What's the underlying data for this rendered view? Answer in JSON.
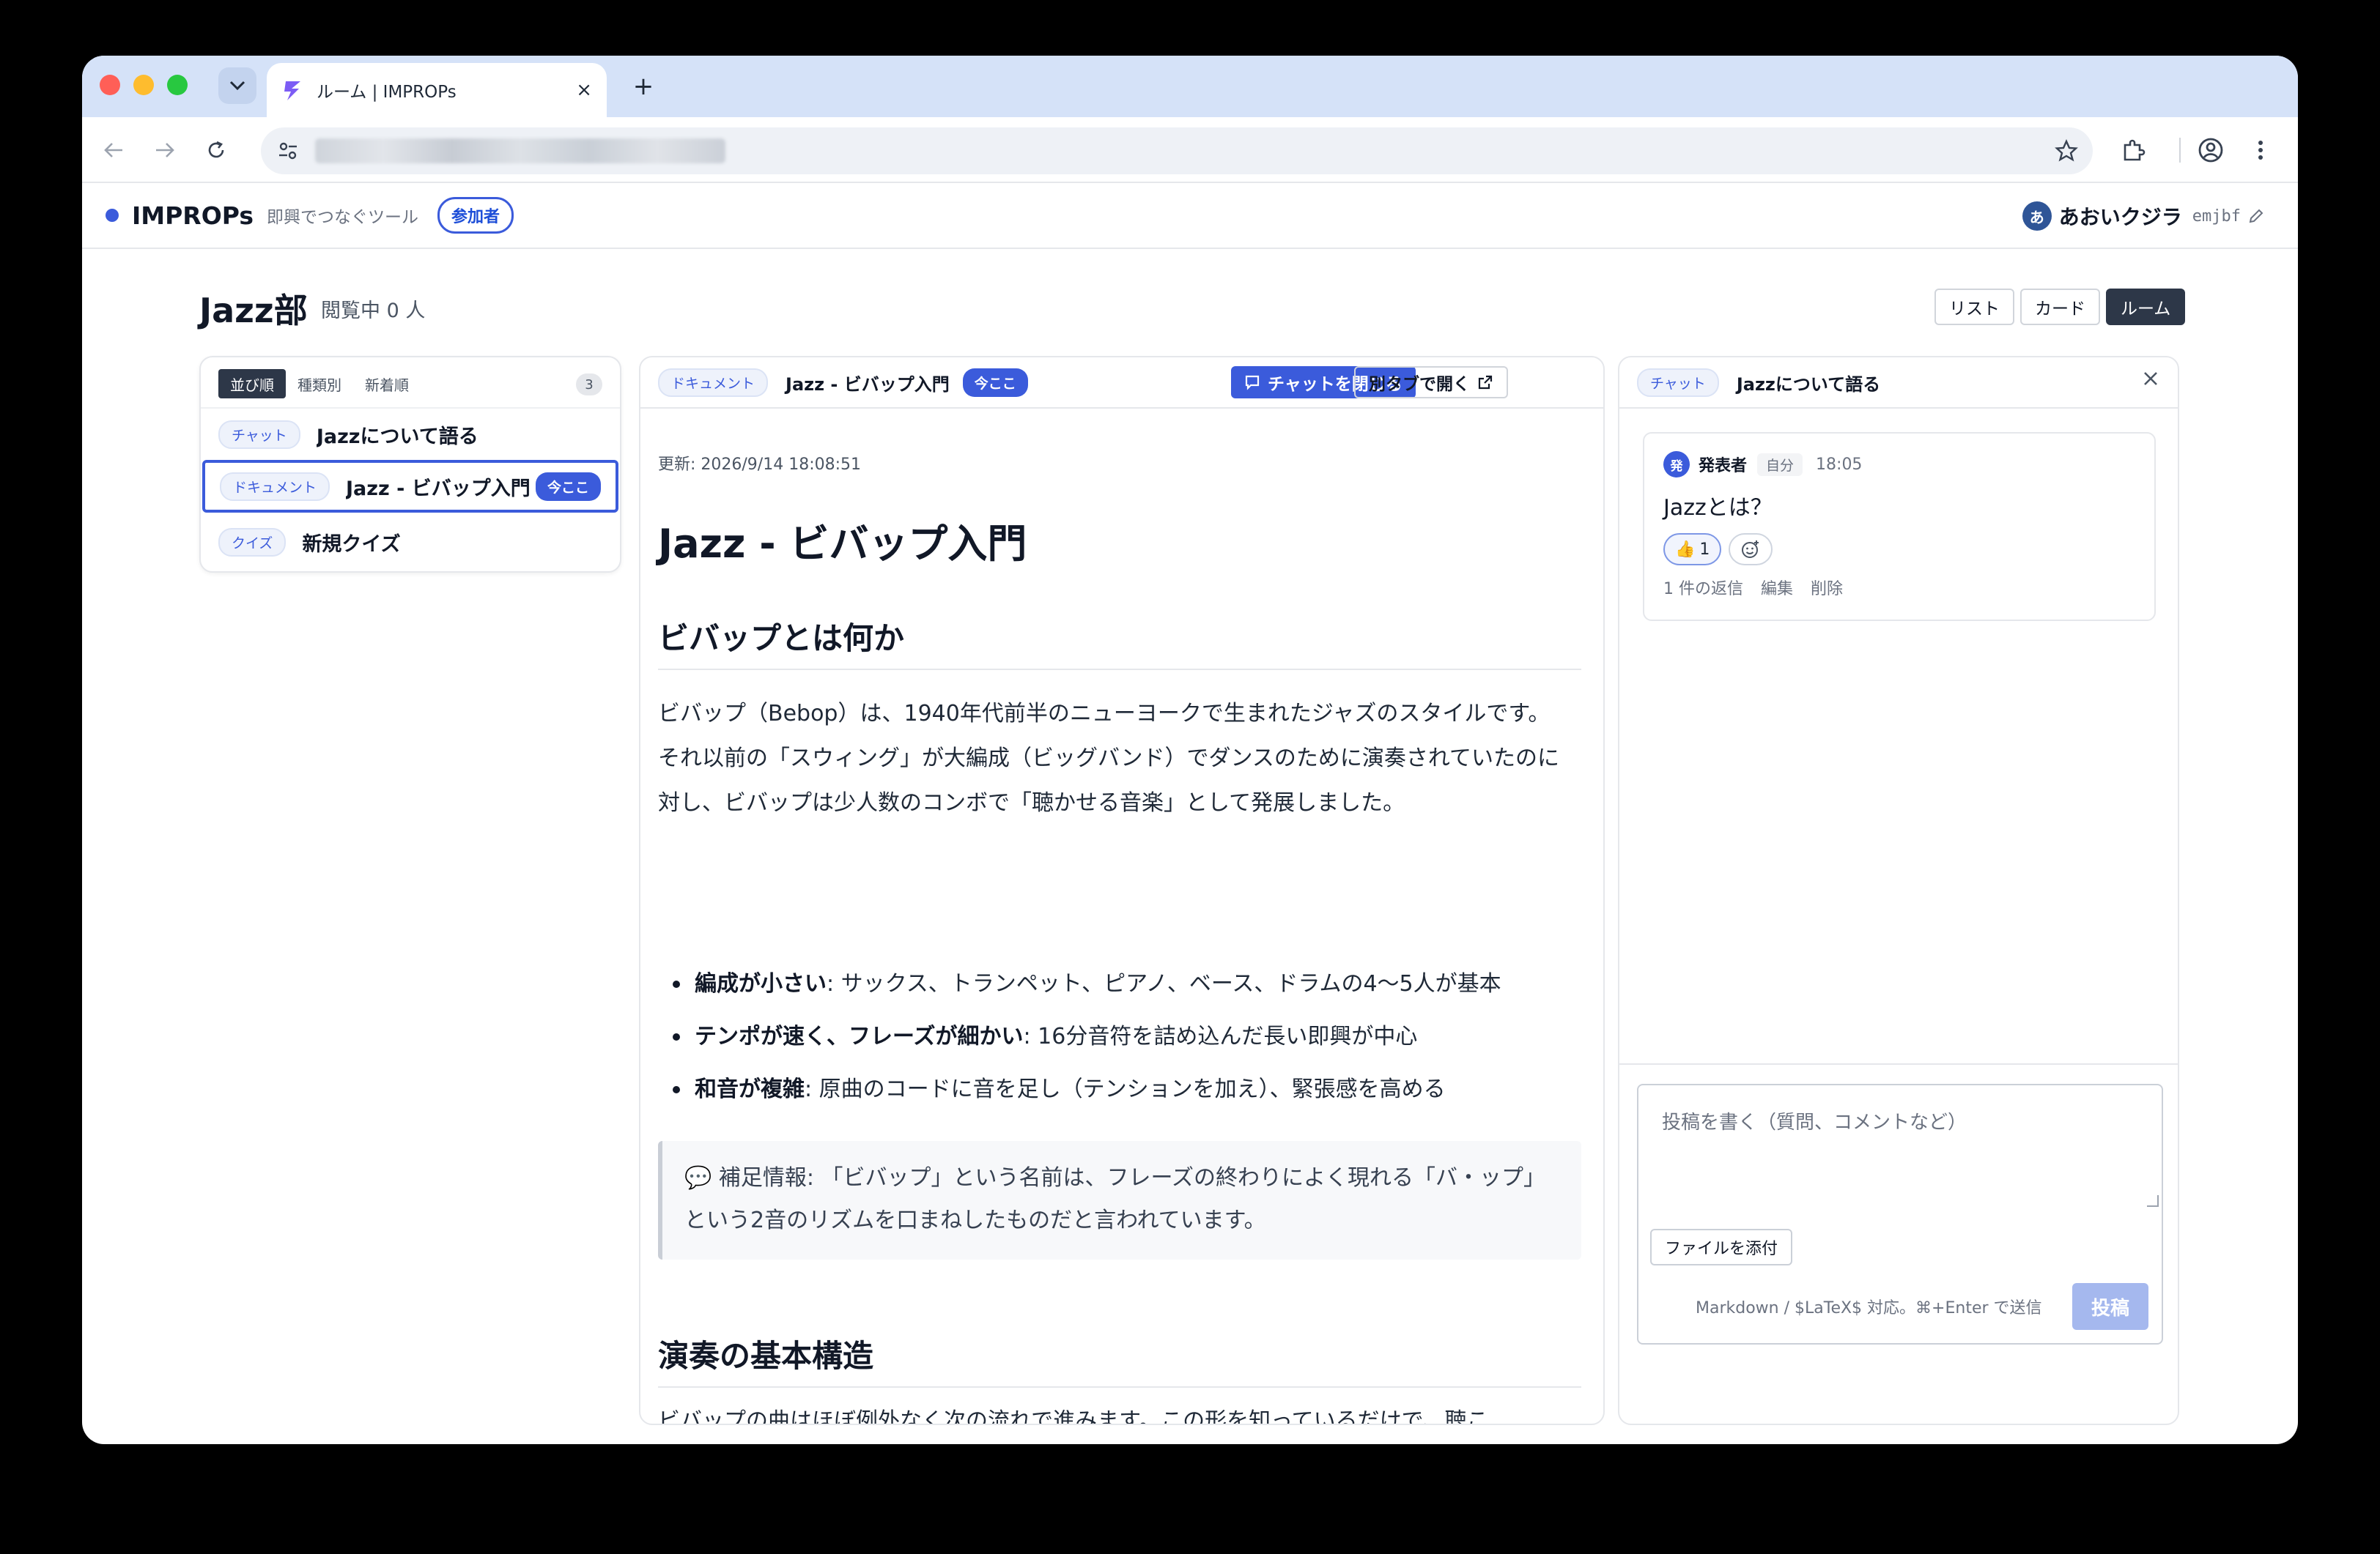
{
  "browser": {
    "tab_title": "ルーム | IMPROPs",
    "tab_close": "×",
    "new_tab": "+"
  },
  "header": {
    "brand": "IMPROPs",
    "tagline": "即興でつなぐツール",
    "role_badge": "参加者",
    "user": {
      "avatar_initial": "あ",
      "name": "あおいクジラ",
      "id": "emjbf"
    }
  },
  "page": {
    "title": "Jazz部",
    "viewer_count": "閲覧中 0 人",
    "view_modes": [
      "リスト",
      "カード",
      "ルーム"
    ],
    "active_view": "ルーム"
  },
  "sidebar": {
    "sort_tabs": [
      "並び順",
      "種類別",
      "新着順"
    ],
    "active_sort": "並び順",
    "count": "3",
    "items": [
      {
        "type": "チャット",
        "title": "Jazzについて語る",
        "here": ""
      },
      {
        "type": "ドキュメント",
        "title": "Jazz - ビバップ入門",
        "here": "今ここ"
      },
      {
        "type": "クイズ",
        "title": "新規クイズ",
        "here": ""
      }
    ]
  },
  "document": {
    "type": "ドキュメント",
    "title": "Jazz - ビバップ入門",
    "here_badge": "今ここ",
    "close_chat_label": "チャットを閉じる",
    "open_new_tab_label": "別タブで開く",
    "updated": "更新: 2026/9/14 18:08:51",
    "h1": "Jazz - ビバップ入門",
    "h2_1": "ビバップとは何か",
    "p1": "ビバップ（Bebop）は、1940年代前半のニューヨークで生まれたジャズのスタイルです。それ以前の「スウィング」が大編成（ビッグバンド）でダンスのために演奏されていたのに対し、ビバップは少人数のコンボで「聴かせる音楽」として発展しました。",
    "bullets": [
      {
        "bold": "編成が小さい",
        "text": ": サックス、トランペット、ピアノ、ベース、ドラムの4〜5人が基本"
      },
      {
        "bold": "テンポが速く、フレーズが細かい",
        "text": ": 16分音符を詰め込んだ長い即興が中心"
      },
      {
        "bold": "和音が複雑",
        "text": ": 原曲のコードに音を足し（テンションを加え）、緊張感を高める"
      }
    ],
    "note": "💬 補足情報: 「ビバップ」という名前は、フレーズの終わりによく現れる「バ・ップ」という2音のリズムを口まねしたものだと言われています。",
    "h2_2": "演奏の基本構造",
    "p2": "ビバップの曲はほぼ例外なく次の流れで進みます。この形を知っているだけで、聴こ"
  },
  "chat": {
    "type": "チャット",
    "title": "Jazzについて語る",
    "message": {
      "avatar_initial": "発",
      "author": "発表者",
      "self_badge": "自分",
      "time": "18:05",
      "body": "Jazzとは？",
      "reaction_emoji": "👍",
      "reaction_count": "1",
      "replies": "1 件の返信",
      "edit": "編集",
      "delete": "削除"
    },
    "composer": {
      "placeholder": "投稿を書く（質問、コメントなど）",
      "attach_label": "ファイルを添付",
      "hint": "Markdown / $LaTeX$ 対応。⌘+Enter で送信",
      "post_label": "投稿"
    }
  },
  "colors": {
    "accent": "#3b5bdb",
    "dark": "#2d3748",
    "tabstrip": "#d5e2f8"
  }
}
